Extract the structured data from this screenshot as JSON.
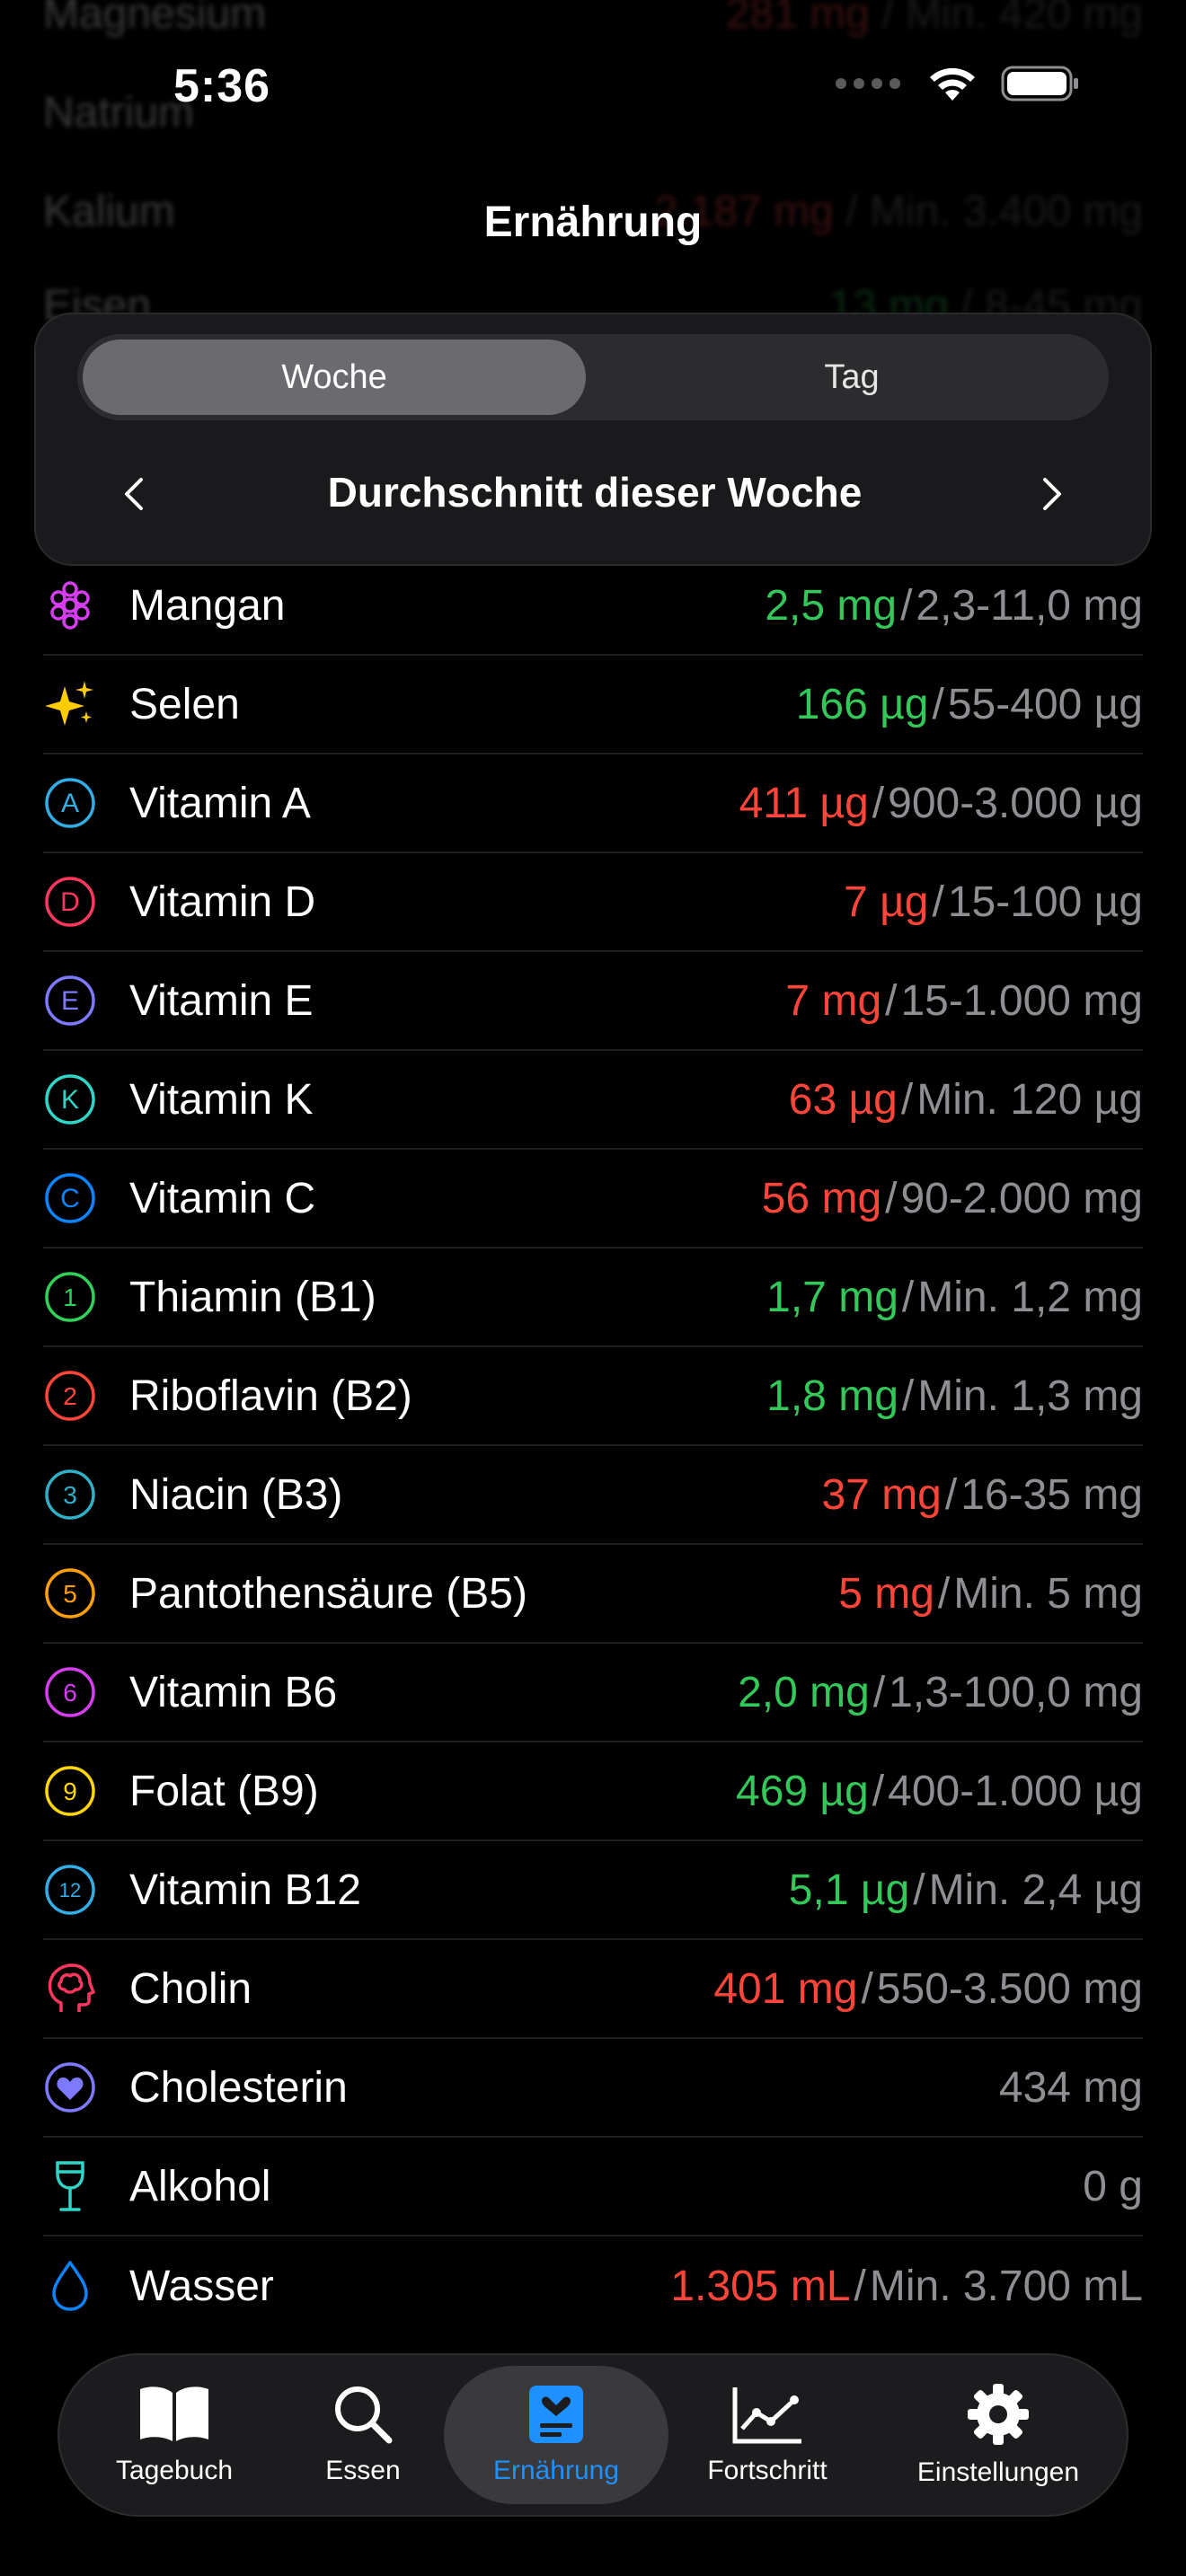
{
  "status": {
    "time": "5:36"
  },
  "page": {
    "title": "Ernährung"
  },
  "background_rows": [
    {
      "name": "Magnesium",
      "value": "281 mg",
      "range": "Min. 420 mg"
    },
    {
      "name": "Natrium",
      "value": "",
      "range": ""
    },
    {
      "name": "Kalium",
      "value": "2.187 mg",
      "range": "Min. 3.400 mg"
    },
    {
      "name": "Eisen",
      "value": "13 mg",
      "range": "8-45 mg"
    }
  ],
  "segmented": {
    "week": "Woche",
    "day": "Tag"
  },
  "period": {
    "label": "Durchschnitt dieser Woche"
  },
  "colors": {
    "ok": "#34c759",
    "bad": "#ff453a",
    "neutral": "#8e8e93",
    "accent": "#1e90ff"
  },
  "nutrients": [
    {
      "name": "Mangan",
      "icon": "grape-icon",
      "value": "2,5 mg",
      "range": "2,3-11,0 mg",
      "status": "ok"
    },
    {
      "name": "Selen",
      "icon": "sparkles-icon",
      "value": "166 µg",
      "range": "55-400 µg",
      "status": "ok"
    },
    {
      "name": "Vitamin A",
      "icon": "letter-a-icon",
      "value": "411 µg",
      "range": "900-3.000 µg",
      "status": "bad"
    },
    {
      "name": "Vitamin D",
      "icon": "letter-d-icon",
      "value": "7 µg",
      "range": "15-100 µg",
      "status": "bad"
    },
    {
      "name": "Vitamin E",
      "icon": "letter-e-icon",
      "value": "7 mg",
      "range": "15-1.000 mg",
      "status": "bad"
    },
    {
      "name": "Vitamin K",
      "icon": "letter-k-icon",
      "value": "63 µg",
      "range": "Min. 120 µg",
      "status": "bad"
    },
    {
      "name": "Vitamin C",
      "icon": "letter-c-icon",
      "value": "56 mg",
      "range": "90-2.000 mg",
      "status": "bad"
    },
    {
      "name": "Thiamin (B1)",
      "icon": "number-1-icon",
      "value": "1,7 mg",
      "range": "Min. 1,2 mg",
      "status": "ok"
    },
    {
      "name": "Riboflavin (B2)",
      "icon": "number-2-icon",
      "value": "1,8 mg",
      "range": "Min. 1,3 mg",
      "status": "ok"
    },
    {
      "name": "Niacin (B3)",
      "icon": "number-3-icon",
      "value": "37 mg",
      "range": "16-35 mg",
      "status": "bad"
    },
    {
      "name": "Pantothensäure (B5)",
      "icon": "number-5-icon",
      "value": "5 mg",
      "range": "Min. 5 mg",
      "status": "bad"
    },
    {
      "name": "Vitamin B6",
      "icon": "number-6-icon",
      "value": "2,0 mg",
      "range": "1,3-100,0 mg",
      "status": "ok"
    },
    {
      "name": "Folat (B9)",
      "icon": "number-9-icon",
      "value": "469 µg",
      "range": "400-1.000 µg",
      "status": "ok"
    },
    {
      "name": "Vitamin B12",
      "icon": "number-12-icon",
      "value": "5,1 µg",
      "range": "Min. 2,4 µg",
      "status": "ok"
    },
    {
      "name": "Cholin",
      "icon": "brain-head-icon",
      "value": "401 mg",
      "range": "550-3.500 mg",
      "status": "bad"
    },
    {
      "name": "Cholesterin",
      "icon": "heart-icon",
      "value": "434 mg",
      "range": "",
      "status": "neutral"
    },
    {
      "name": "Alkohol",
      "icon": "wine-glass-icon",
      "value": "0 g",
      "range": "",
      "status": "neutral"
    },
    {
      "name": "Wasser",
      "icon": "water-drop-icon",
      "value": "1.305 mL",
      "range": "Min. 3.700 mL",
      "status": "bad"
    }
  ],
  "tabs": [
    {
      "label": "Tagebuch",
      "icon": "book-icon"
    },
    {
      "label": "Essen",
      "icon": "search-icon"
    },
    {
      "label": "Ernährung",
      "icon": "nutrition-icon",
      "active": true
    },
    {
      "label": "Fortschritt",
      "icon": "chart-icon"
    },
    {
      "label": "Einstellungen",
      "icon": "gear-icon"
    }
  ]
}
